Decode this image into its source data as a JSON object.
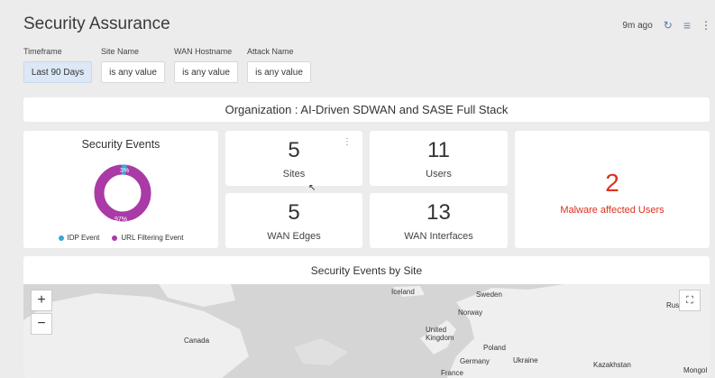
{
  "header": {
    "title": "Security Assurance",
    "last_updated": "9m ago",
    "icons": [
      "refresh-icon",
      "filter-icon",
      "more-vert-icon"
    ]
  },
  "filters": [
    {
      "label": "Timeframe",
      "value": "Last 90 Days",
      "active": true
    },
    {
      "label": "Site Name",
      "value": "is any value",
      "active": false
    },
    {
      "label": "WAN Hostname",
      "value": "is any value",
      "active": false
    },
    {
      "label": "Attack Name",
      "value": "is any value",
      "active": false
    }
  ],
  "organization": "Organization : AI-Driven SDWAN and SASE Full Stack",
  "security_events": {
    "title": "Security Events",
    "slices": [
      {
        "name": "IDP Event",
        "percent": 3,
        "label": "3%",
        "color": "#3aa6d8"
      },
      {
        "name": "URL Filtering Event",
        "percent": 97,
        "label": "97%",
        "color": "#a93aa6"
      }
    ]
  },
  "metrics": {
    "sites": {
      "value": "5",
      "label": "Sites"
    },
    "users": {
      "value": "11",
      "label": "Users"
    },
    "wan_edges": {
      "value": "5",
      "label": "WAN Edges"
    },
    "wan_interfaces": {
      "value": "13",
      "label": "WAN Interfaces"
    }
  },
  "malware": {
    "value": "2",
    "label": "Malware affected Users",
    "color": "#e0301e"
  },
  "map": {
    "title": "Security Events by Site",
    "labels": [
      "Iceland",
      "Sweden",
      "Norway",
      "Canada",
      "United Kingdom",
      "Poland",
      "Germany",
      "Ukraine",
      "Kazakhstan",
      "France",
      "Rus",
      "Mongol"
    ],
    "zoom_in": "+",
    "zoom_out": "−"
  }
}
